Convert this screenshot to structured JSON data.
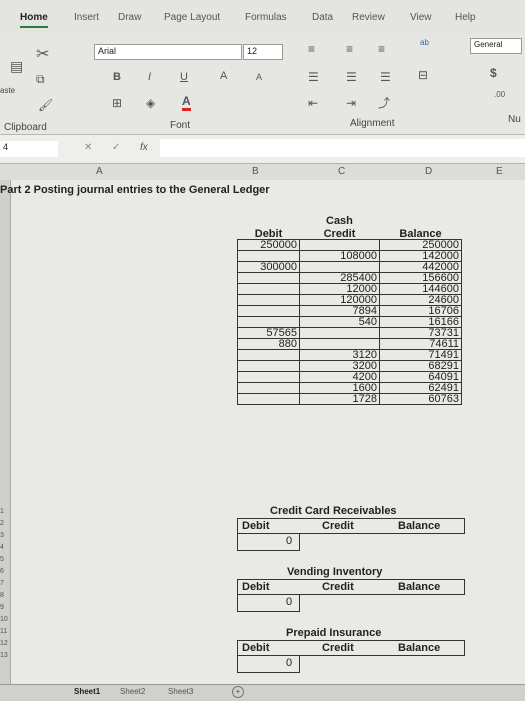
{
  "ribbon": {
    "tabs": [
      "Home",
      "Insert",
      "Draw",
      "Page Layout",
      "Formulas",
      "Data",
      "Review",
      "View",
      "Help"
    ],
    "font_name": "Arial",
    "font_size": "12",
    "number_format": "General",
    "paste_label": "aste",
    "group_labels": {
      "clipboard": "Clipboard",
      "font": "Font",
      "alignment": "Alignment",
      "number": "Nu"
    },
    "bold": "B",
    "italic": "I",
    "underline": "U",
    "font_color": "A",
    "grow": "A",
    "shrink": "A",
    "currency": "$",
    "decimal": ".00",
    "wrap": "ab"
  },
  "formula_bar": {
    "name_box": "4",
    "fx": "fx",
    "cancel": "✕",
    "confirm": "✓"
  },
  "columns": [
    "A",
    "B",
    "C",
    "D",
    "E"
  ],
  "rows": [
    "1",
    "2",
    "3",
    "4",
    "5",
    "6",
    "7",
    "8",
    "9",
    "10",
    "11",
    "12",
    "13"
  ],
  "title": "Part 2  Posting journal entries to the General Ledger",
  "cash": {
    "name": "Cash",
    "headers": [
      "Debit",
      "Credit",
      "Balance"
    ],
    "rows": [
      {
        "debit": "250000",
        "credit": "",
        "balance": "250000"
      },
      {
        "debit": "",
        "credit": "108000",
        "balance": "142000"
      },
      {
        "debit": "300000",
        "credit": "",
        "balance": "442000"
      },
      {
        "debit": "",
        "credit": "285400",
        "balance": "156600"
      },
      {
        "debit": "",
        "credit": "12000",
        "balance": "144600"
      },
      {
        "debit": "",
        "credit": "120000",
        "balance": "24600"
      },
      {
        "debit": "",
        "credit": "7894",
        "balance": "16706"
      },
      {
        "debit": "",
        "credit": "540",
        "balance": "16166"
      },
      {
        "debit": "57565",
        "credit": "",
        "balance": "73731"
      },
      {
        "debit": "880",
        "credit": "",
        "balance": "74611"
      },
      {
        "debit": "",
        "credit": "3120",
        "balance": "71491"
      },
      {
        "debit": "",
        "credit": "3200",
        "balance": "68291"
      },
      {
        "debit": "",
        "credit": "4200",
        "balance": "64091"
      },
      {
        "debit": "",
        "credit": "1600",
        "balance": "62491"
      },
      {
        "debit": "",
        "credit": "1728",
        "balance": "60763"
      }
    ]
  },
  "accounts": [
    {
      "name": "Credit Card Receivables",
      "debit": "Debit",
      "credit": "Credit",
      "balance": "Balance",
      "zero": "0"
    },
    {
      "name": "Vending Inventory",
      "debit": "Debit",
      "credit": "Credit",
      "balance": "Balance",
      "zero": "0"
    },
    {
      "name": "Prepaid Insurance",
      "debit": "Debit",
      "credit": "Credit",
      "balance": "Balance",
      "zero": "0"
    }
  ],
  "sheet_tabs": [
    "Sheet1",
    "Sheet2",
    "Sheet3"
  ],
  "add_sheet": "+"
}
